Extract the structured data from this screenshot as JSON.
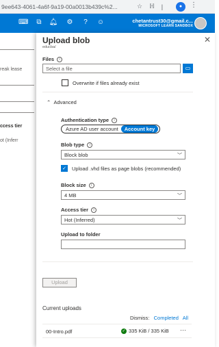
{
  "browser": {
    "url": "9ee643-4061-4a6f-9a19-00a0013b439c%2...",
    "profile_initial": "●"
  },
  "header": {
    "email": "chetantrust30@gmail.c...",
    "sandbox": "MICROSOFT LEARN SANDBOX",
    "icons": [
      "terminal-icon",
      "directory-icon",
      "notifications-icon",
      "settings-icon",
      "help-icon",
      "feedback-icon"
    ]
  },
  "background": {
    "texts": [
      "reak lease",
      "ccess tier",
      "ot (Inferr"
    ]
  },
  "blade": {
    "title": "Upload blob",
    "subtitle": "educba/",
    "files": {
      "label": "Files",
      "placeholder": "Select a file"
    },
    "overwrite_label": "Overwrite if files already exist",
    "advanced": {
      "label": "Advanced",
      "auth_label": "Authentication type",
      "auth_options": [
        "Azure AD user account",
        "Account key"
      ],
      "auth_selected": "Account key",
      "blob_type_label": "Blob type",
      "blob_type_value": "Block blob",
      "vhd_label": "Upload .vhd files as page blobs (recommended)",
      "block_size_label": "Block size",
      "block_size_value": "4 MB",
      "access_tier_label": "Access tier",
      "access_tier_value": "Hot (Inferred)",
      "folder_label": "Upload to folder",
      "folder_value": ""
    },
    "upload_button": "Upload",
    "current_uploads": {
      "title": "Current uploads",
      "dismiss_label": "Dismiss:",
      "dismiss_completed": "Completed",
      "dismiss_all": "All",
      "items": [
        {
          "name": "00-Intro.pdf",
          "progress": "335 KiB / 335 KiB"
        }
      ]
    }
  }
}
